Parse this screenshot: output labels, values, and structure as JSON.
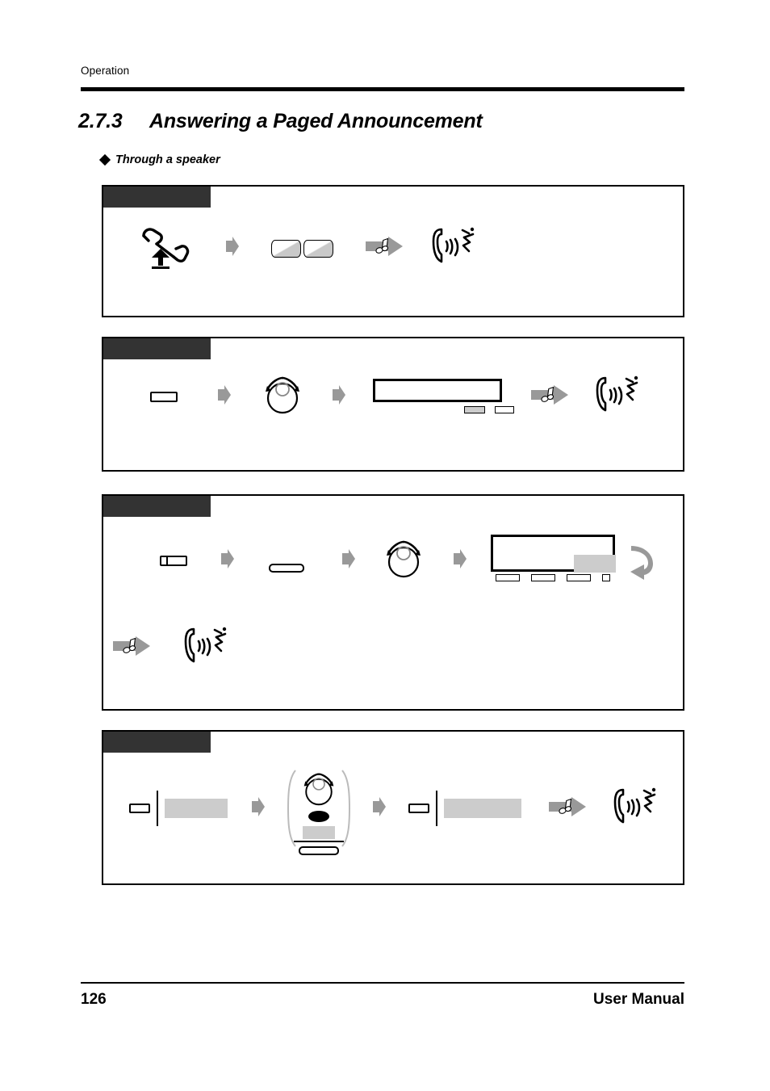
{
  "page": {
    "running_header": "Operation",
    "section_number": "2.7.3",
    "section_title": "Answering a Paged Announcement",
    "subsection_title": "Through a speaker",
    "footer_page_number": "126",
    "footer_label": "User Manual"
  },
  "colors": {
    "tab_black": "#333333",
    "rule_black": "#000000",
    "gray_fill": "#cccccc",
    "arrow_gray": "#999999",
    "key_shade": "#c9c9c9",
    "page_background": "#ffffff"
  },
  "procedures": [
    {
      "tab_label": "",
      "steps": [
        {
          "icon": "lift-handset-icon",
          "label": ""
        },
        {
          "icon": "step-arrow-icon",
          "label": ""
        },
        {
          "icon": "keypad-key-pair-icon",
          "label": ""
        },
        {
          "icon": "tone-arrow-icon",
          "label": ""
        },
        {
          "icon": "talk-icon",
          "label": ""
        }
      ]
    },
    {
      "tab_label": "",
      "steps": [
        {
          "icon": "sp-phone-button-icon",
          "label": ""
        },
        {
          "icon": "step-arrow-icon",
          "label": ""
        },
        {
          "icon": "dial-tone-icon",
          "label": ""
        },
        {
          "icon": "step-arrow-icon",
          "label": ""
        },
        {
          "icon": "lcd-display-icon",
          "label": ""
        },
        {
          "icon": "tone-arrow-icon",
          "label": ""
        },
        {
          "icon": "talk-icon",
          "label": ""
        }
      ]
    },
    {
      "tab_label": "",
      "steps": [
        {
          "icon": "sp-phone-split-button-icon",
          "label": ""
        },
        {
          "icon": "step-arrow-icon",
          "label": ""
        },
        {
          "icon": "feature-button-icon",
          "label": ""
        },
        {
          "icon": "step-arrow-icon",
          "label": ""
        },
        {
          "icon": "dial-tone-icon",
          "label": ""
        },
        {
          "icon": "step-arrow-icon",
          "label": ""
        },
        {
          "icon": "lcd-display-wide-icon",
          "label": ""
        },
        {
          "icon": "return-arrow-icon",
          "label": ""
        },
        {
          "icon": "tone-arrow-icon",
          "label": ""
        },
        {
          "icon": "talk-icon",
          "label": ""
        }
      ]
    },
    {
      "tab_label": "",
      "steps": [
        {
          "icon": "labeled-key-icon",
          "label": ""
        },
        {
          "icon": "step-arrow-icon",
          "label": ""
        },
        {
          "icon": "portable-handset-icon",
          "label": ""
        },
        {
          "icon": "step-arrow-icon",
          "label": ""
        },
        {
          "icon": "labeled-key-wide-icon",
          "label": ""
        },
        {
          "icon": "tone-arrow-icon",
          "label": ""
        },
        {
          "icon": "talk-icon",
          "label": ""
        }
      ]
    }
  ]
}
